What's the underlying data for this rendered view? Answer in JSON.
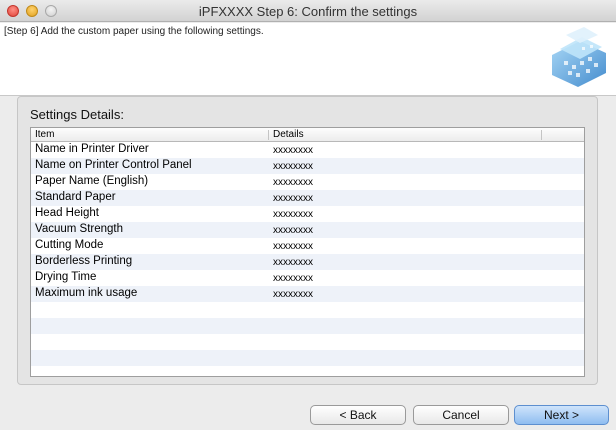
{
  "window": {
    "title": "iPFXXXX Step 6: Confirm the settings"
  },
  "header": {
    "instruction": "[Step 6] Add the custom paper using the following settings.",
    "graphic_icon": "printer-paper-graphic"
  },
  "settings": {
    "group_label": "Settings Details:",
    "columns": {
      "item": "Item",
      "details": "Details"
    },
    "rows": [
      {
        "item": "Name in Printer Driver",
        "details": "xxxxxxxx"
      },
      {
        "item": "Name on Printer Control Panel",
        "details": "xxxxxxxx"
      },
      {
        "item": "Paper Name (English)",
        "details": "xxxxxxxx"
      },
      {
        "item": "Standard Paper",
        "details": "xxxxxxxx"
      },
      {
        "item": "Head Height",
        "details": "xxxxxxxx"
      },
      {
        "item": "Vacuum Strength",
        "details": "xxxxxxxx"
      },
      {
        "item": "Cutting Mode",
        "details": "xxxxxxxx"
      },
      {
        "item": "Borderless Printing",
        "details": "xxxxxxxx"
      },
      {
        "item": "Drying Time",
        "details": "xxxxxxxx"
      },
      {
        "item": "Maximum ink usage",
        "details": "xxxxxxxx"
      }
    ]
  },
  "buttons": {
    "back": "< Back",
    "cancel": "Cancel",
    "next": "Next >"
  },
  "colors": {
    "accent": "#5d8fcf",
    "row_stripe": "#eef2f9"
  }
}
